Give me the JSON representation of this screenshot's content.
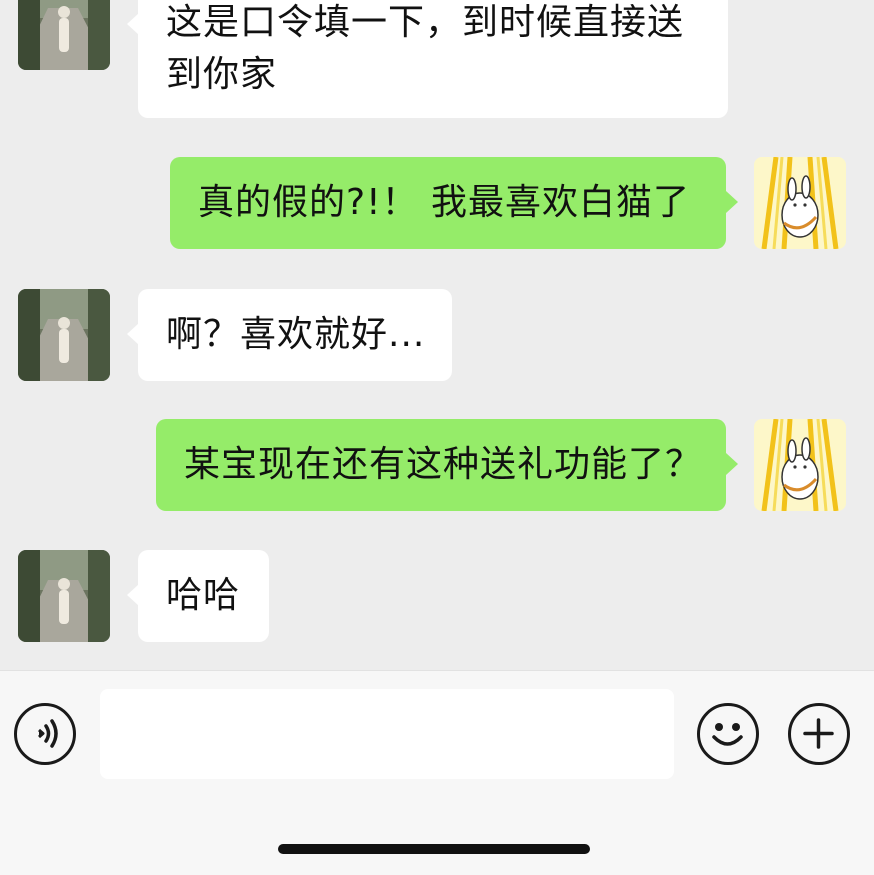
{
  "messages": [
    {
      "id": 1,
      "side": "in",
      "lines": [
        "这是口令填一下，到时候直接送",
        "到你家"
      ]
    },
    {
      "id": 2,
      "side": "out",
      "lines": [
        "真的假的?!！ 我最喜欢白猫了"
      ]
    },
    {
      "id": 3,
      "side": "in",
      "lines": [
        "啊？喜欢就好..."
      ]
    },
    {
      "id": 4,
      "side": "out",
      "lines": [
        "某宝现在还有这种送礼功能了？"
      ]
    },
    {
      "id": 5,
      "side": "in",
      "lines": [
        "哈哈"
      ]
    }
  ],
  "input": {
    "value": "",
    "placeholder": ""
  },
  "icons": {
    "voice": "voice-icon",
    "emoji": "emoji-icon",
    "more": "plus-icon"
  },
  "colors": {
    "chat_background": "#ededed",
    "incoming_bubble": "#ffffff",
    "outgoing_bubble": "#95ec69",
    "input_bar": "#f7f7f7"
  }
}
